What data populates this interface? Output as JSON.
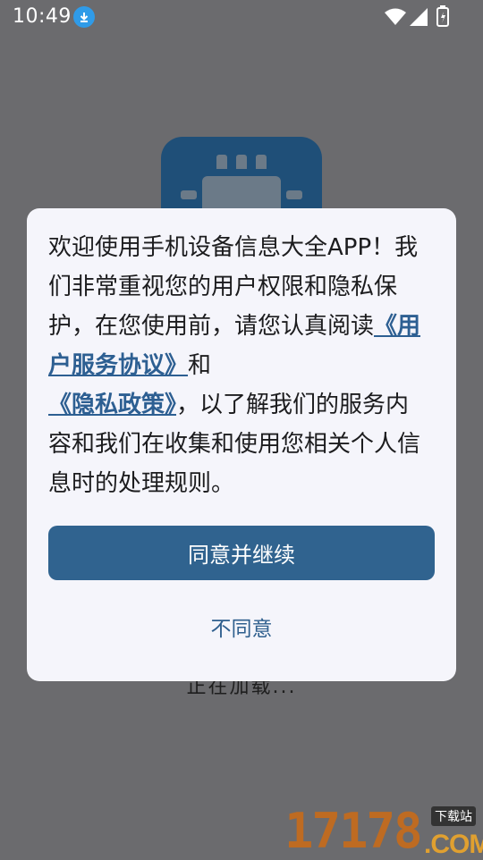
{
  "status_bar": {
    "time": "10:49"
  },
  "splash": {
    "loading_text": "正在加载..."
  },
  "dialog": {
    "message_part1": "欢迎使用手机设备信息大全APP！我们非常重视您的用户权限和隐私保护，在您使用前，请您认真阅读",
    "user_agreement_link": "《用户服务协议》",
    "message_and": "和",
    "privacy_policy_link": "《隐私政策》",
    "message_part2": "，以了解我们的服务内容和我们在收集和使用您相关个人信息时的处理规则。",
    "agree_label": "同意并继续",
    "disagree_label": "不同意"
  },
  "watermark": {
    "number": "17178",
    "tag": "下载站",
    "domain": ".COM"
  },
  "colors": {
    "overlay": "#6b6b6e",
    "dialog_bg": "#f5f5fb",
    "primary": "#30638f",
    "link": "#2d5f92"
  }
}
